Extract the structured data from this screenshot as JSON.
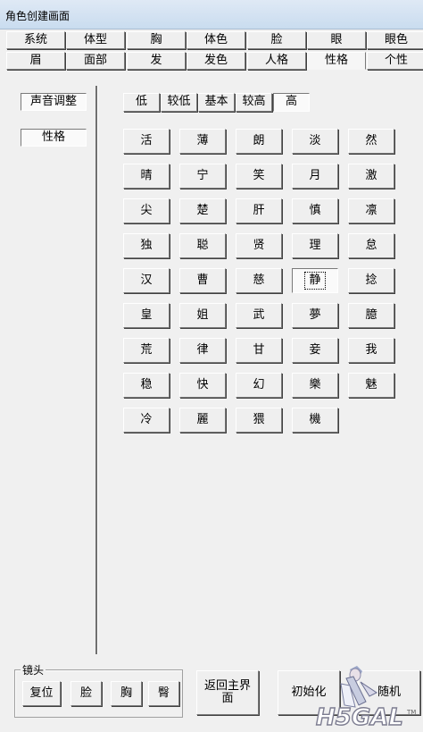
{
  "window": {
    "title": "角色创建画面"
  },
  "tabs_row1": [
    "系统",
    "体型",
    "胸",
    "体色",
    "脸",
    "眼",
    "眼色"
  ],
  "tabs_row2": [
    "眉",
    "面部",
    "发",
    "发色",
    "人格",
    "性格",
    "个性"
  ],
  "active_tab": "性格",
  "side_buttons": [
    "声音调整",
    "性格"
  ],
  "level_buttons": [
    "低",
    "较低",
    "基本",
    "较高",
    "高"
  ],
  "selected_level": "高",
  "traits": [
    "活",
    "薄",
    "朗",
    "淡",
    "然",
    "晴",
    "宁",
    "笑",
    "月",
    "激",
    "尖",
    "楚",
    "肝",
    "慎",
    "凛",
    "独",
    "聪",
    "贤",
    "理",
    "怠",
    "汉",
    "曹",
    "慈",
    "静",
    "捻",
    "皇",
    "姐",
    "武",
    "夢",
    "臆",
    "荒",
    "律",
    "甘",
    "妾",
    "我",
    "稳",
    "快",
    "幻",
    "樂",
    "魅",
    "冷",
    "麗",
    "猥",
    "機"
  ],
  "selected_trait": "静",
  "camera": {
    "legend": "镜头",
    "buttons": [
      "复位",
      "脸",
      "胸",
      "臀"
    ]
  },
  "bottom": {
    "back": "返回主界面",
    "init": "初始化",
    "random": "随机"
  },
  "watermark": "H5GAL"
}
